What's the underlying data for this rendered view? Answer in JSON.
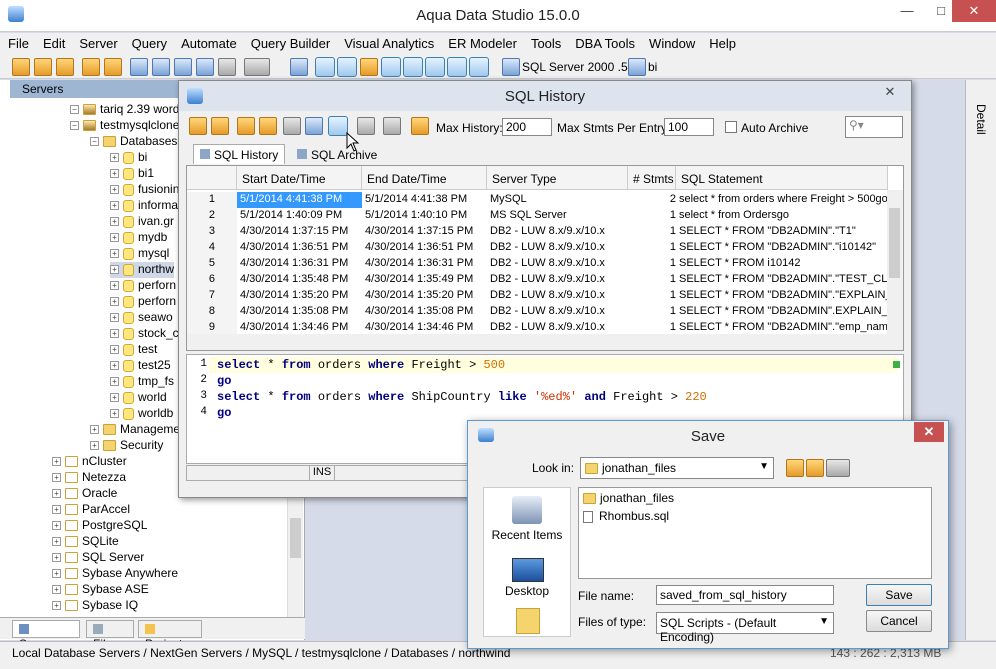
{
  "app": {
    "title": "Aqua Data Studio 15.0.0"
  },
  "menu": [
    "File",
    "Edit",
    "Server",
    "Query",
    "Automate",
    "Query Builder",
    "Visual Analytics",
    "ER Modeler",
    "Tools",
    "DBA Tools",
    "Window",
    "Help"
  ],
  "toolbar": {
    "server_label": "SQL Server 2000 .54",
    "db_label": "bi"
  },
  "left_panel": {
    "header": "Servers",
    "tree": [
      {
        "label": "tariq 2.39 word"
      },
      {
        "label": "testmysqlclone"
      },
      {
        "label": "Databases"
      },
      {
        "label": "bi"
      },
      {
        "label": "bi1"
      },
      {
        "label": "fusionin"
      },
      {
        "label": "informa"
      },
      {
        "label": "ivan.gr"
      },
      {
        "label": "mydb"
      },
      {
        "label": "mysql"
      },
      {
        "label": "northw"
      },
      {
        "label": "perforn"
      },
      {
        "label": "perforn"
      },
      {
        "label": "seawo"
      },
      {
        "label": "stock_c"
      },
      {
        "label": "test"
      },
      {
        "label": "test25"
      },
      {
        "label": "tmp_fs"
      },
      {
        "label": "world"
      },
      {
        "label": "worldb"
      },
      {
        "label": "Manageme"
      },
      {
        "label": "Security"
      },
      {
        "label": "nCluster"
      },
      {
        "label": "Netezza"
      },
      {
        "label": "Oracle"
      },
      {
        "label": "ParAccel"
      },
      {
        "label": "PostgreSQL"
      },
      {
        "label": "SQLite"
      },
      {
        "label": "SQL Server"
      },
      {
        "label": "Sybase Anywhere"
      },
      {
        "label": "Sybase ASE"
      },
      {
        "label": "Sybase IQ"
      }
    ],
    "tabs": [
      "Servers",
      "Files",
      "Projects"
    ]
  },
  "right_strip": {
    "label": "Detail"
  },
  "status": {
    "path": "Local Database Servers / NextGen Servers / MySQL / testmysqlclone / Databases / northwind",
    "size": "143 : 262 : 2,313 MB"
  },
  "history": {
    "title": "SQL History",
    "max_history_label": "Max History:",
    "max_history": "200",
    "max_stmts_label": "Max Stmts Per Entry:",
    "max_stmts": "100",
    "auto_archive": "Auto Archive",
    "tabs": [
      "SQL History",
      "SQL Archive"
    ],
    "columns": [
      "Start Date/Time",
      "End Date/Time",
      "Server Type",
      "# Stmts",
      "SQL Statement"
    ],
    "rows": [
      {
        "n": "1",
        "start": "5/1/2014 4:41:38 PM",
        "end": "5/1/2014 4:41:38 PM",
        "type": "MySQL",
        "stmts": "2",
        "sql": "select * from orders where Freight > 500go"
      },
      {
        "n": "2",
        "start": "5/1/2014 1:40:09 PM",
        "end": "5/1/2014 1:40:10 PM",
        "type": "MS SQL Server",
        "stmts": "1",
        "sql": "select * from Ordersgo"
      },
      {
        "n": "3",
        "start": "4/30/2014 1:37:15 PM",
        "end": "4/30/2014 1:37:15 PM",
        "type": "DB2 - LUW 8.x/9.x/10.x",
        "stmts": "1",
        "sql": "SELECT * FROM \"DB2ADMIN\".\"T1\""
      },
      {
        "n": "4",
        "start": "4/30/2014 1:36:51 PM",
        "end": "4/30/2014 1:36:51 PM",
        "type": "DB2 - LUW 8.x/9.x/10.x",
        "stmts": "1",
        "sql": "SELECT * FROM \"DB2ADMIN\".\"i10142\""
      },
      {
        "n": "5",
        "start": "4/30/2014 1:36:31 PM",
        "end": "4/30/2014 1:36:31 PM",
        "type": "DB2 - LUW 8.x/9.x/10.x",
        "stmts": "1",
        "sql": "SELECT * FROM i10142"
      },
      {
        "n": "6",
        "start": "4/30/2014 1:35:48 PM",
        "end": "4/30/2014 1:35:49 PM",
        "type": "DB2 - LUW 8.x/9.x/10.x",
        "stmts": "1",
        "sql": "SELECT * FROM \"DB2ADMIN\".\"TEST_CLOB\""
      },
      {
        "n": "7",
        "start": "4/30/2014 1:35:20 PM",
        "end": "4/30/2014 1:35:20 PM",
        "type": "DB2 - LUW 8.x/9.x/10.x",
        "stmts": "1",
        "sql": "SELECT * FROM \"DB2ADMIN\".\"EXPLAIN_STR"
      },
      {
        "n": "8",
        "start": "4/30/2014 1:35:08 PM",
        "end": "4/30/2014 1:35:08 PM",
        "type": "DB2 - LUW 8.x/9.x/10.x",
        "stmts": "1",
        "sql": "SELECT * FROM \"DB2ADMIN\".EXPLAIN_STR"
      },
      {
        "n": "9",
        "start": "4/30/2014 1:34:46 PM",
        "end": "4/30/2014 1:34:46 PM",
        "type": "DB2 - LUW 8.x/9.x/10.x",
        "stmts": "1",
        "sql": "SELECT * FROM \"DB2ADMIN\".\"emp_name\""
      }
    ],
    "editor_lines": [
      "1",
      "2",
      "3",
      "4"
    ],
    "mode": "INS"
  },
  "save": {
    "title": "Save",
    "look_in_label": "Look in:",
    "look_in": "jonathan_files",
    "places": [
      "Recent Items",
      "Desktop"
    ],
    "files": [
      "jonathan_files",
      "Rhombus.sql"
    ],
    "filename_label": "File name:",
    "filename": "saved_from_sql_history",
    "type_label": "Files of type:",
    "type": "SQL Scripts - (Default Encoding)",
    "save_btn": "Save",
    "cancel_btn": "Cancel"
  }
}
